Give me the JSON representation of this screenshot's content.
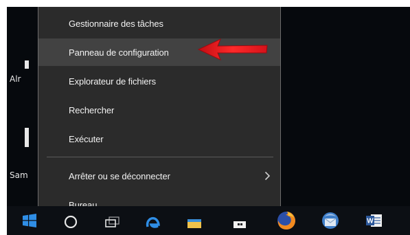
{
  "desktop": {
    "icons": [
      {
        "label": "Alr"
      },
      {
        "label": "Sam"
      }
    ]
  },
  "context_menu": {
    "items": [
      {
        "label": "Gestionnaire des tâches"
      },
      {
        "label": "Panneau de configuration",
        "highlighted": true
      },
      {
        "label": "Explorateur de fichiers"
      },
      {
        "label": "Rechercher"
      },
      {
        "label": "Exécuter"
      },
      {
        "label": "Arrêter ou se déconnecter",
        "has_submenu": true,
        "submenu_icon": "chevron-right-icon"
      },
      {
        "label": "Bureau"
      }
    ],
    "colors": {
      "background": "#2b2b2b",
      "hover": "#424242",
      "text": "#f2f2f2"
    }
  },
  "annotation": {
    "icon": "red-arrow-icon",
    "color": "#e8141c"
  },
  "taskbar": {
    "icons": [
      {
        "name": "windows-start-icon"
      },
      {
        "name": "cortana-search-icon"
      },
      {
        "name": "task-view-icon"
      },
      {
        "name": "edge-browser-icon"
      },
      {
        "name": "file-explorer-icon"
      },
      {
        "name": "store-icon"
      },
      {
        "name": "firefox-icon"
      },
      {
        "name": "thunderbird-icon"
      },
      {
        "name": "word-icon"
      }
    ]
  }
}
